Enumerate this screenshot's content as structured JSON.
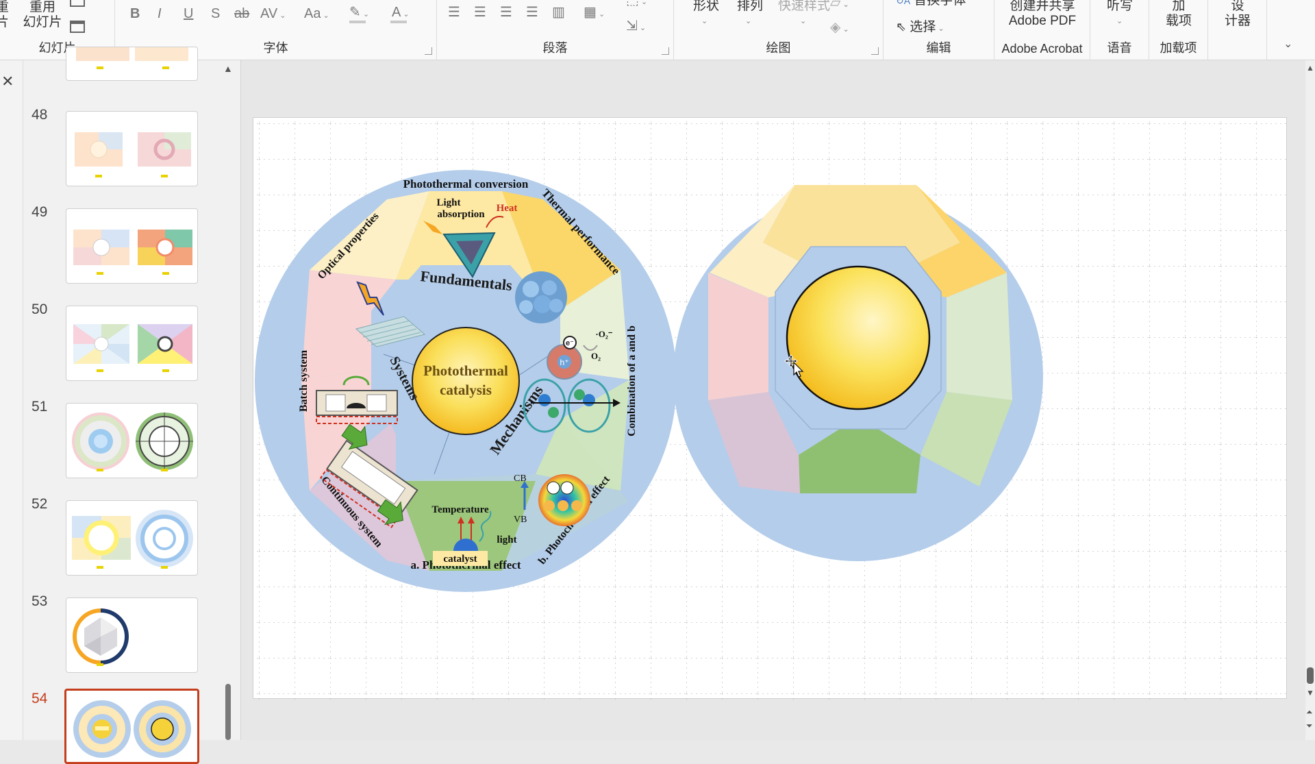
{
  "ribbon": {
    "left_cut_top": "重",
    "left_cut_bottom": "片",
    "reuse_label_top": "重用",
    "reuse_label_bottom": "幻灯片",
    "groups": {
      "slides": "幻灯片",
      "font": "字体",
      "paragraph": "段落",
      "drawing": "绘图",
      "editing": "编辑",
      "acrobat": "Adobe Acrobat",
      "voice": "语音",
      "addins": "加载项"
    },
    "font_buttons": [
      "B",
      "I",
      "U",
      "S",
      "ab",
      "AV",
      "Aa",
      "A"
    ],
    "shape_label": "形状",
    "arrange_label": "排列",
    "quickstyle_label": "快速样式",
    "replace_font_label": "替换字体",
    "select_label": "选择",
    "acrobat_label_1": "创建并共享",
    "acrobat_label_2": "Adobe PDF",
    "dictate_label": "听写",
    "addins_label_1": "加",
    "addins_label_2": "载项",
    "designer_label_1": "设",
    "designer_label_2": "计器"
  },
  "thumbnails": [
    {
      "number": "48"
    },
    {
      "number": "49"
    },
    {
      "number": "50"
    },
    {
      "number": "51"
    },
    {
      "number": "52"
    },
    {
      "number": "53"
    },
    {
      "number": "54",
      "selected": true
    }
  ],
  "slide": {
    "center_title_line1": "Photothermal",
    "center_title_line2": "catalysis",
    "inner_labels": {
      "fundamentals": "Fundamentals",
      "systems": "Systems",
      "mechanisms": "Mechanisms"
    },
    "outer_labels": {
      "photothermal_conversion": "Photothermal conversion",
      "thermal_performance": "Thermal performance",
      "combination": "Combination of a and b",
      "photochemical": "b. Photochemical effect",
      "photothermal_effect": "a. Photothermal effect",
      "continuous": "Continuous system",
      "batch": "Batch system",
      "optical": "Optical properties"
    },
    "figure_labels": {
      "light_absorption_1": "Light",
      "light_absorption_2": "absorption",
      "heat": "Heat",
      "o2_radical": "·O₂⁻",
      "o2": "O₂",
      "electron": "e⁻",
      "hole": "h⁺",
      "cb": "CB",
      "vb": "VB",
      "temperature": "Temperature",
      "light": "light",
      "catalyst": "catalyst"
    }
  },
  "colors": {
    "accent_selected": "#c43e1c",
    "ring_blue": "#b4cdea",
    "center_yellow": "#f6d23a"
  }
}
